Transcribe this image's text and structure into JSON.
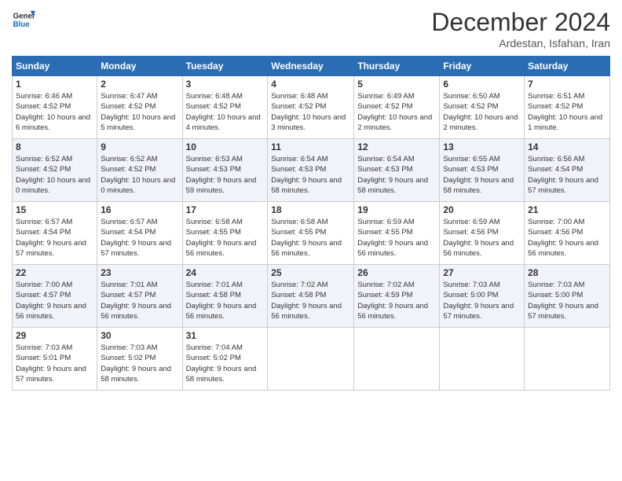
{
  "logo": {
    "general": "General",
    "blue": "Blue"
  },
  "header": {
    "month": "December 2024",
    "location": "Ardestan, Isfahan, Iran"
  },
  "weekdays": [
    "Sunday",
    "Monday",
    "Tuesday",
    "Wednesday",
    "Thursday",
    "Friday",
    "Saturday"
  ],
  "weeks": [
    [
      {
        "day": "1",
        "sunrise": "6:46 AM",
        "sunset": "4:52 PM",
        "daylight": "10 hours and 6 minutes."
      },
      {
        "day": "2",
        "sunrise": "6:47 AM",
        "sunset": "4:52 PM",
        "daylight": "10 hours and 5 minutes."
      },
      {
        "day": "3",
        "sunrise": "6:48 AM",
        "sunset": "4:52 PM",
        "daylight": "10 hours and 4 minutes."
      },
      {
        "day": "4",
        "sunrise": "6:48 AM",
        "sunset": "4:52 PM",
        "daylight": "10 hours and 3 minutes."
      },
      {
        "day": "5",
        "sunrise": "6:49 AM",
        "sunset": "4:52 PM",
        "daylight": "10 hours and 2 minutes."
      },
      {
        "day": "6",
        "sunrise": "6:50 AM",
        "sunset": "4:52 PM",
        "daylight": "10 hours and 2 minutes."
      },
      {
        "day": "7",
        "sunrise": "6:51 AM",
        "sunset": "4:52 PM",
        "daylight": "10 hours and 1 minute."
      }
    ],
    [
      {
        "day": "8",
        "sunrise": "6:52 AM",
        "sunset": "4:52 PM",
        "daylight": "10 hours and 0 minutes."
      },
      {
        "day": "9",
        "sunrise": "6:52 AM",
        "sunset": "4:52 PM",
        "daylight": "10 hours and 0 minutes."
      },
      {
        "day": "10",
        "sunrise": "6:53 AM",
        "sunset": "4:53 PM",
        "daylight": "9 hours and 59 minutes."
      },
      {
        "day": "11",
        "sunrise": "6:54 AM",
        "sunset": "4:53 PM",
        "daylight": "9 hours and 58 minutes."
      },
      {
        "day": "12",
        "sunrise": "6:54 AM",
        "sunset": "4:53 PM",
        "daylight": "9 hours and 58 minutes."
      },
      {
        "day": "13",
        "sunrise": "6:55 AM",
        "sunset": "4:53 PM",
        "daylight": "9 hours and 58 minutes."
      },
      {
        "day": "14",
        "sunrise": "6:56 AM",
        "sunset": "4:54 PM",
        "daylight": "9 hours and 57 minutes."
      }
    ],
    [
      {
        "day": "15",
        "sunrise": "6:57 AM",
        "sunset": "4:54 PM",
        "daylight": "9 hours and 57 minutes."
      },
      {
        "day": "16",
        "sunrise": "6:57 AM",
        "sunset": "4:54 PM",
        "daylight": "9 hours and 57 minutes."
      },
      {
        "day": "17",
        "sunrise": "6:58 AM",
        "sunset": "4:55 PM",
        "daylight": "9 hours and 56 minutes."
      },
      {
        "day": "18",
        "sunrise": "6:58 AM",
        "sunset": "4:55 PM",
        "daylight": "9 hours and 56 minutes."
      },
      {
        "day": "19",
        "sunrise": "6:59 AM",
        "sunset": "4:55 PM",
        "daylight": "9 hours and 56 minutes."
      },
      {
        "day": "20",
        "sunrise": "6:59 AM",
        "sunset": "4:56 PM",
        "daylight": "9 hours and 56 minutes."
      },
      {
        "day": "21",
        "sunrise": "7:00 AM",
        "sunset": "4:56 PM",
        "daylight": "9 hours and 56 minutes."
      }
    ],
    [
      {
        "day": "22",
        "sunrise": "7:00 AM",
        "sunset": "4:57 PM",
        "daylight": "9 hours and 56 minutes."
      },
      {
        "day": "23",
        "sunrise": "7:01 AM",
        "sunset": "4:57 PM",
        "daylight": "9 hours and 56 minutes."
      },
      {
        "day": "24",
        "sunrise": "7:01 AM",
        "sunset": "4:58 PM",
        "daylight": "9 hours and 56 minutes."
      },
      {
        "day": "25",
        "sunrise": "7:02 AM",
        "sunset": "4:58 PM",
        "daylight": "9 hours and 56 minutes."
      },
      {
        "day": "26",
        "sunrise": "7:02 AM",
        "sunset": "4:59 PM",
        "daylight": "9 hours and 56 minutes."
      },
      {
        "day": "27",
        "sunrise": "7:03 AM",
        "sunset": "5:00 PM",
        "daylight": "9 hours and 57 minutes."
      },
      {
        "day": "28",
        "sunrise": "7:03 AM",
        "sunset": "5:00 PM",
        "daylight": "9 hours and 57 minutes."
      }
    ],
    [
      {
        "day": "29",
        "sunrise": "7:03 AM",
        "sunset": "5:01 PM",
        "daylight": "9 hours and 57 minutes."
      },
      {
        "day": "30",
        "sunrise": "7:03 AM",
        "sunset": "5:02 PM",
        "daylight": "9 hours and 58 minutes."
      },
      {
        "day": "31",
        "sunrise": "7:04 AM",
        "sunset": "5:02 PM",
        "daylight": "9 hours and 58 minutes."
      },
      null,
      null,
      null,
      null
    ]
  ]
}
